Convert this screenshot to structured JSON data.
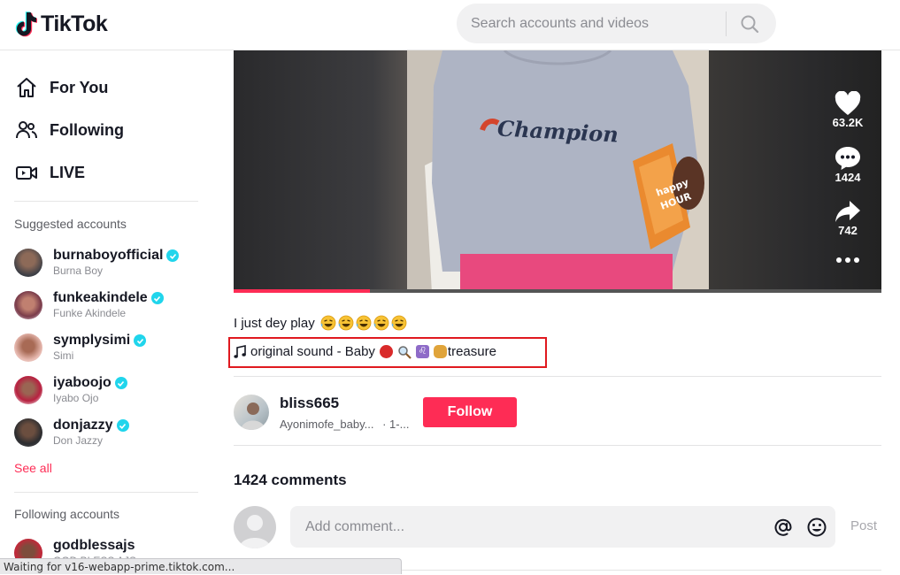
{
  "header": {
    "logo_text": "TikTok",
    "search_placeholder": "Search accounts and videos"
  },
  "sidebar": {
    "nav": [
      {
        "label": "For You",
        "icon": "home-icon"
      },
      {
        "label": "Following",
        "icon": "people-icon"
      },
      {
        "label": "LIVE",
        "icon": "live-icon"
      }
    ],
    "suggested_title": "Suggested accounts",
    "suggested": [
      {
        "username": "burnaboyofficial",
        "display": "Burna Boy",
        "verified": true
      },
      {
        "username": "funkeakindele",
        "display": "Funke Akindele",
        "verified": true
      },
      {
        "username": "symplysimi",
        "display": "Simi",
        "verified": true
      },
      {
        "username": "iyaboojo",
        "display": "Iyabo Ojo",
        "verified": true
      },
      {
        "username": "donjazzy",
        "display": "Don Jazzy",
        "verified": true
      }
    ],
    "see_all": "See all",
    "following_title": "Following accounts",
    "following": [
      {
        "username": "godblessajs",
        "display": "GOD BLESS AJS"
      }
    ]
  },
  "video": {
    "progress_fraction": 0.21,
    "likes": "63.2K",
    "comments": "1424",
    "shares": "742",
    "shirt_text": "Champion",
    "box_text_1": "happy",
    "box_text_2": "HOUR"
  },
  "post": {
    "caption": "I just dey play",
    "caption_emoji_count": 5,
    "sound_prefix": "original sound - Baby",
    "sound_suffix": "treasure",
    "author_username": "bliss665",
    "author_nickname": "Ayonimofe_baby...",
    "author_date": "· 1-...",
    "follow_label": "Follow"
  },
  "comments": {
    "count_label": "1424 comments",
    "placeholder": "Add comment...",
    "post_label": "Post"
  },
  "status_bar": "Waiting for v16-webapp-prime.tiktok.com...",
  "colors": {
    "brand": "#fe2c55",
    "verified": "#20d5ec",
    "highlight": "#e0191f"
  }
}
